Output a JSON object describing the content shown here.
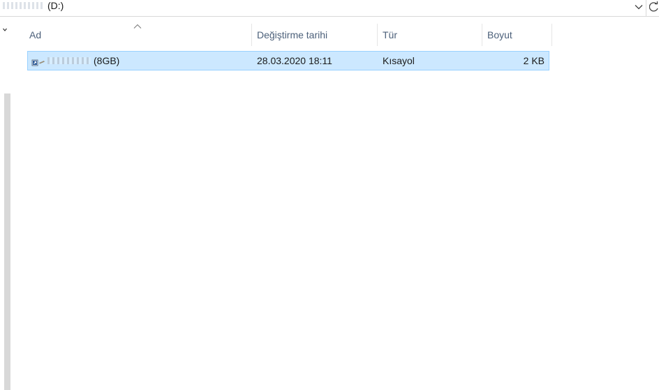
{
  "address_bar": {
    "path_label": "(D:)",
    "dropdown_icon": "chevron-down-icon",
    "refresh_icon": "refresh-icon"
  },
  "columns": {
    "name": "Ad",
    "date_modified": "Değiştirme tarihi",
    "type": "Tür",
    "size": "Boyut"
  },
  "sort": {
    "column": "name",
    "icon": "sort-up-icon"
  },
  "files": [
    {
      "name": "(8GB)",
      "date_modified": "28.03.2020 18:11",
      "type": "Kısayol",
      "size": "2 KB",
      "icon": "shortcut-icon",
      "selected": true
    }
  ],
  "colors": {
    "selection_bg": "#cce8ff",
    "selection_border": "#99d1ff",
    "header_text": "#4c607a"
  }
}
